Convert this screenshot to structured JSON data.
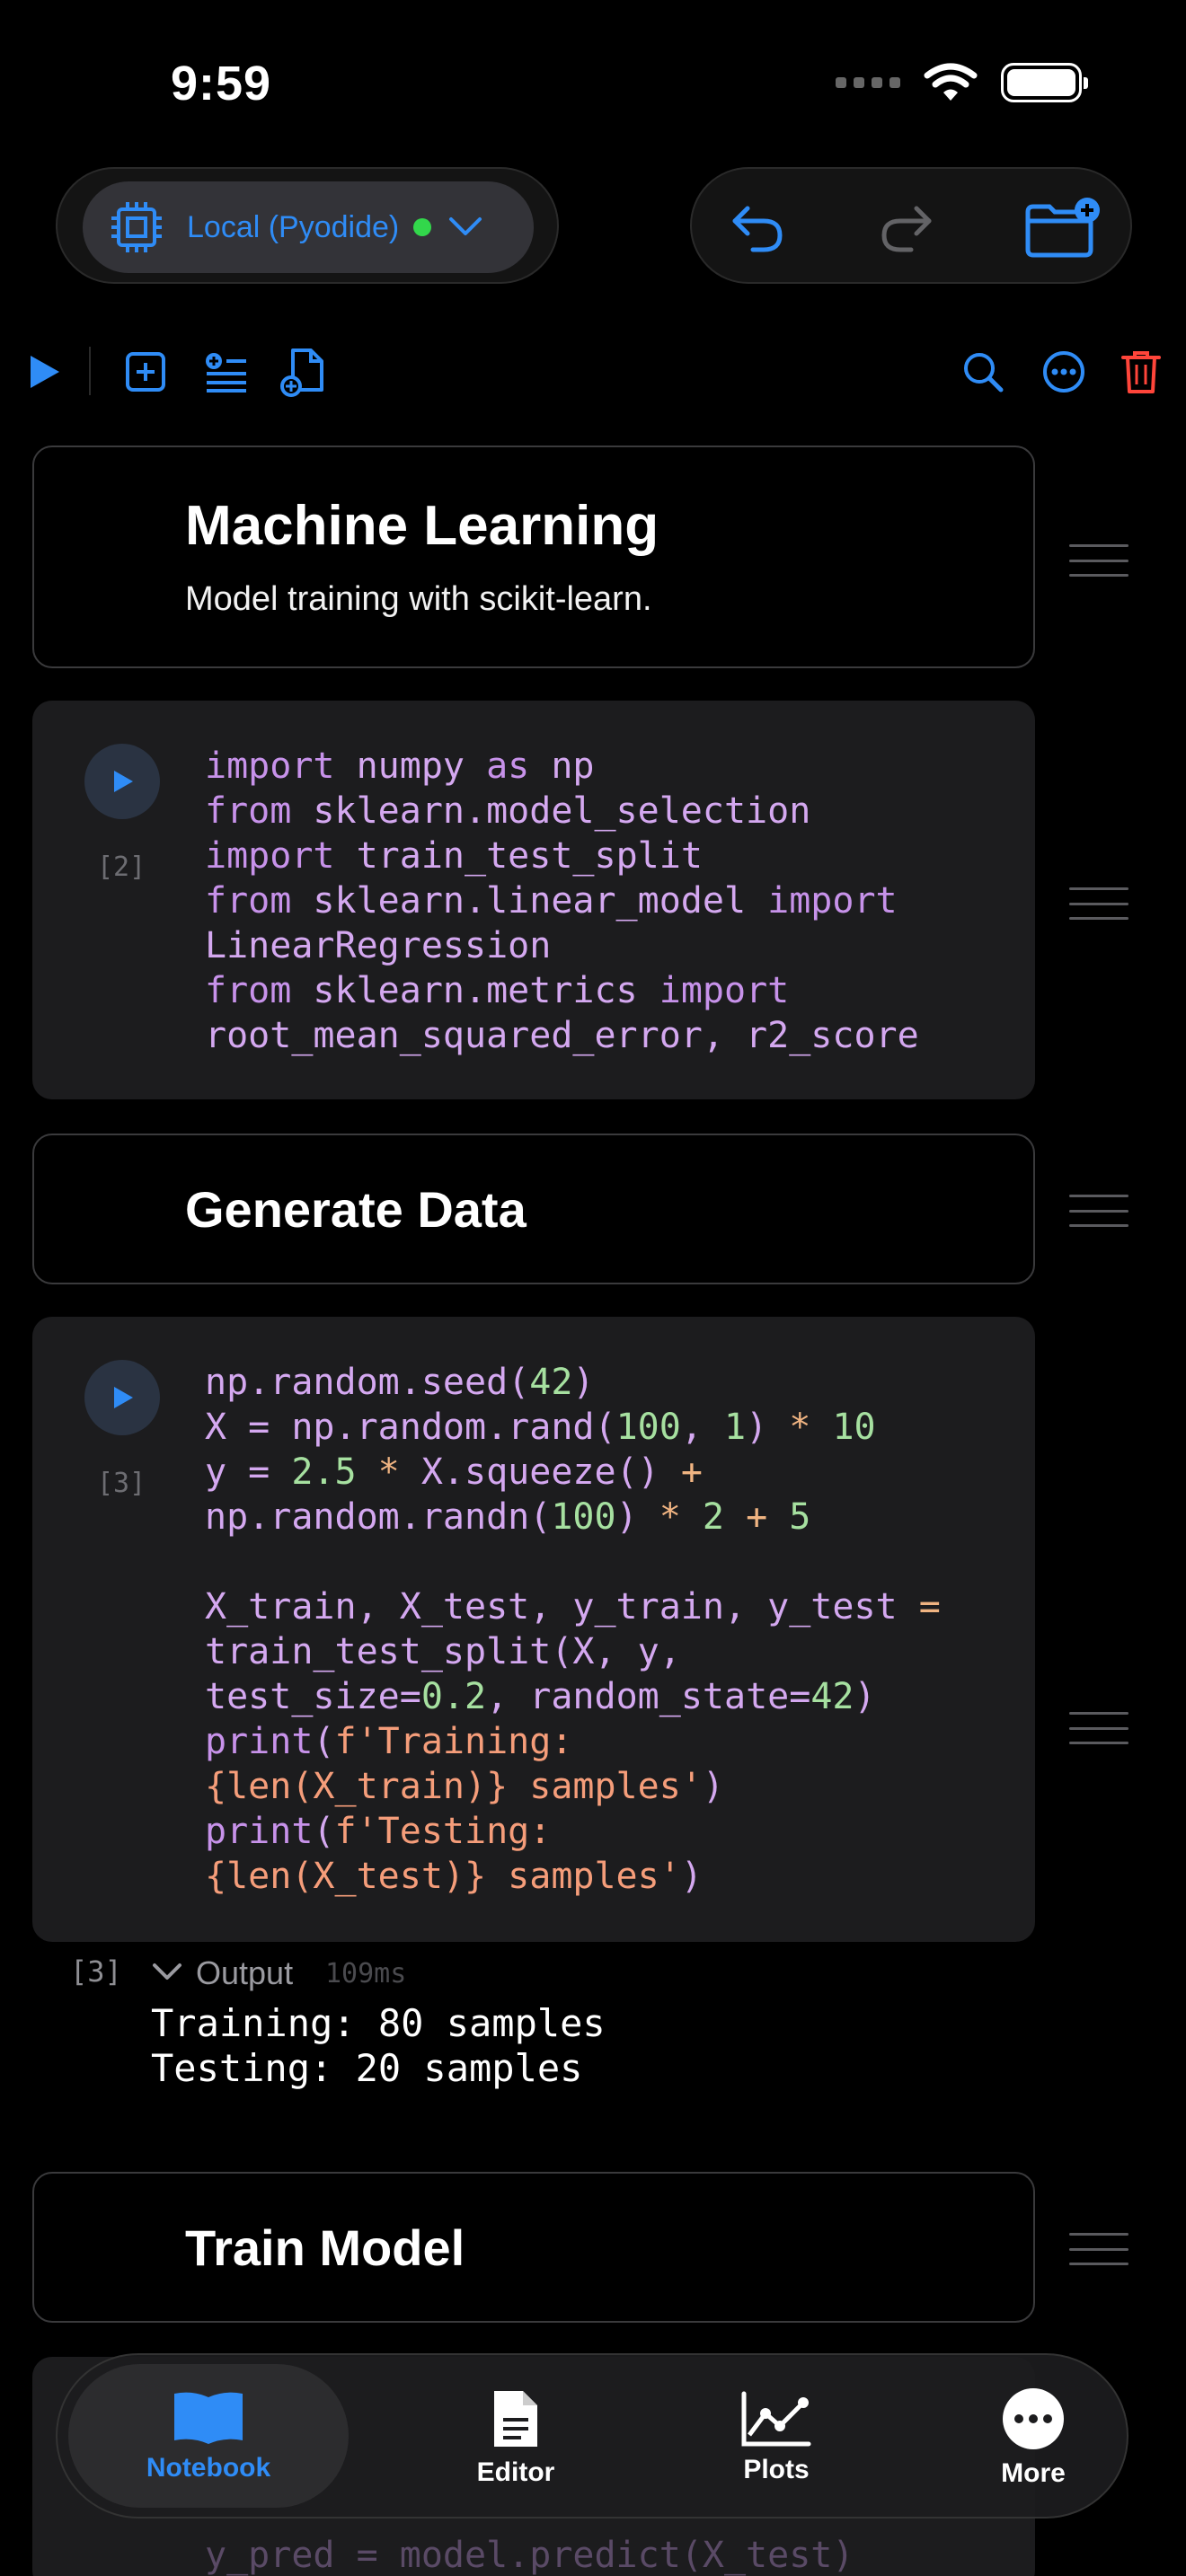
{
  "status": {
    "time": "9:59"
  },
  "runtime": {
    "label": "Local (Pyodide)",
    "status_color": "#32d74b"
  },
  "colors": {
    "accent": "#2f8cf6",
    "danger": "#ff453a",
    "background": "#000000",
    "cell_bg": "#1c1c1e"
  },
  "cells": [
    {
      "type": "markdown",
      "title": "Machine Learning",
      "subtitle": "Model training with scikit-learn."
    },
    {
      "type": "code",
      "exec_count": "[2]"
    },
    {
      "type": "markdown",
      "title": "Generate Data"
    },
    {
      "type": "code",
      "exec_count": "[3]"
    },
    {
      "type": "markdown",
      "title": "Train Model"
    }
  ],
  "output": {
    "count": "[3]",
    "label": "Output",
    "duration": "109ms",
    "lines": "Training: 80 samples\nTesting: 20 samples"
  },
  "code_peek": "y_pred = model.predict(X_test)",
  "tabs": [
    {
      "label": "Notebook",
      "icon": "book-icon",
      "active": true
    },
    {
      "label": "Editor",
      "icon": "document-icon",
      "active": false
    },
    {
      "label": "Plots",
      "icon": "chart-icon",
      "active": false
    },
    {
      "label": "More",
      "icon": "ellipsis-icon",
      "active": false
    }
  ]
}
